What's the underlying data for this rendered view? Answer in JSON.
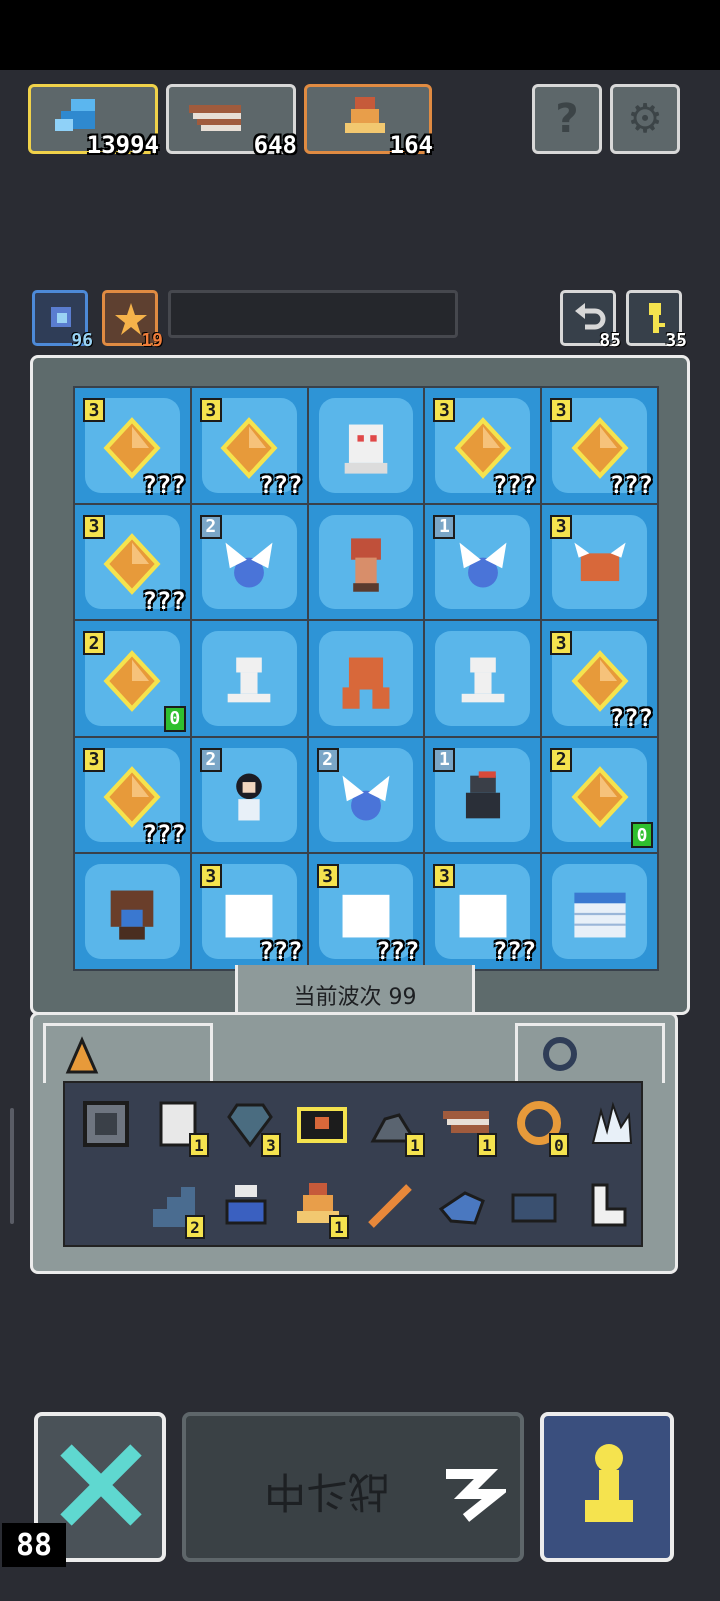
{
  "resources": {
    "gems": "13994",
    "planks": "648",
    "bells": "164"
  },
  "secondary": {
    "boost_count": "96",
    "burst_count": "19",
    "undo_count": "85",
    "keys_count": "35"
  },
  "board": {
    "cells": [
      {
        "lvl": "3",
        "tag": "???",
        "kind": "gem"
      },
      {
        "lvl": "3",
        "tag": "???",
        "kind": "gem"
      },
      {
        "lvl": "",
        "tag": "",
        "kind": "ghost"
      },
      {
        "lvl": "3",
        "tag": "???",
        "kind": "gem"
      },
      {
        "lvl": "3",
        "tag": "???",
        "kind": "gem"
      },
      {
        "lvl": "3",
        "tag": "???",
        "kind": "gem"
      },
      {
        "lvl": "2",
        "tag": "",
        "kind": "fairy"
      },
      {
        "lvl": "",
        "tag": "",
        "kind": "brute"
      },
      {
        "lvl": "1",
        "tag": "",
        "kind": "fairy"
      },
      {
        "lvl": "3",
        "tag": "",
        "kind": "crab"
      },
      {
        "lvl": "2",
        "tag": "0",
        "kind": "gem"
      },
      {
        "lvl": "",
        "tag": "",
        "kind": "skeleton"
      },
      {
        "lvl": "",
        "tag": "",
        "kind": "golem"
      },
      {
        "lvl": "",
        "tag": "",
        "kind": "skeleton"
      },
      {
        "lvl": "3",
        "tag": "???",
        "kind": "gem"
      },
      {
        "lvl": "3",
        "tag": "???",
        "kind": "gem"
      },
      {
        "lvl": "2",
        "tag": "",
        "kind": "girl"
      },
      {
        "lvl": "2",
        "tag": "",
        "kind": "fairy"
      },
      {
        "lvl": "1",
        "tag": "",
        "kind": "bird"
      },
      {
        "lvl": "2",
        "tag": "0",
        "kind": "gem"
      },
      {
        "lvl": "",
        "tag": "",
        "kind": "tree"
      },
      {
        "lvl": "3",
        "tag": "???",
        "kind": "blank"
      },
      {
        "lvl": "3",
        "tag": "???",
        "kind": "blank"
      },
      {
        "lvl": "3",
        "tag": "???",
        "kind": "blank"
      },
      {
        "lvl": "",
        "tag": "",
        "kind": "wall"
      }
    ],
    "wave_label": "当前波次 99"
  },
  "inventory": {
    "items": [
      {
        "name": "cage",
        "n": ""
      },
      {
        "name": "scroll",
        "n": "1"
      },
      {
        "name": "shield-heart",
        "n": "3"
      },
      {
        "name": "box",
        "n": ""
      },
      {
        "name": "stone",
        "n": "1"
      },
      {
        "name": "plank",
        "n": "1"
      },
      {
        "name": "shrimp",
        "n": "0"
      },
      {
        "name": "crystal",
        "n": ""
      },
      {
        "name": "stairs",
        "n": "2"
      },
      {
        "name": "cauldron",
        "n": ""
      },
      {
        "name": "bell",
        "n": "1"
      },
      {
        "name": "stick",
        "n": ""
      },
      {
        "name": "fish",
        "n": ""
      },
      {
        "name": "debris",
        "n": ""
      },
      {
        "name": "boot",
        "n": ""
      }
    ]
  },
  "bottom": {
    "fight_label": "战斗中",
    "fps": "88"
  },
  "colors": {
    "cell_blue": "#2e94d6",
    "gem_orange": "#e79a3a",
    "badge_yellow": "#f5e34e"
  }
}
